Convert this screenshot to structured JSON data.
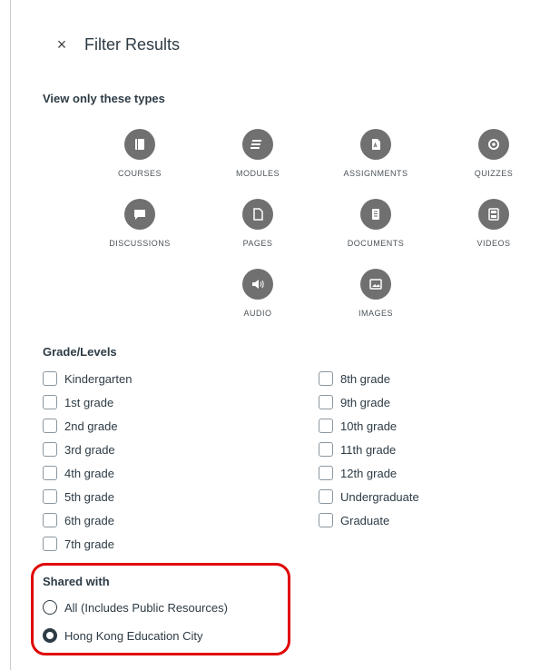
{
  "header": {
    "close_icon": "×",
    "title": "Filter Results"
  },
  "types": {
    "heading": "View only these types",
    "items": [
      {
        "label": "COURSES",
        "icon": "course-icon"
      },
      {
        "label": "MODULES",
        "icon": "modules-icon"
      },
      {
        "label": "ASSIGNMENTS",
        "icon": "assignment-icon"
      },
      {
        "label": "QUIZZES",
        "icon": "quiz-icon"
      },
      {
        "label": "DISCUSSIONS",
        "icon": "discussion-icon"
      },
      {
        "label": "PAGES",
        "icon": "page-icon"
      },
      {
        "label": "DOCUMENTS",
        "icon": "document-icon"
      },
      {
        "label": "VIDEOS",
        "icon": "video-icon"
      },
      {
        "label": "AUDIO",
        "icon": "audio-icon"
      },
      {
        "label": "IMAGES",
        "icon": "image-icon"
      }
    ]
  },
  "grades": {
    "heading": "Grade/Levels",
    "items": [
      "Kindergarten",
      "1st grade",
      "2nd grade",
      "3rd grade",
      "4th grade",
      "5th grade",
      "6th grade",
      "7th grade",
      "8th grade",
      "9th grade",
      "10th grade",
      "11th grade",
      "12th grade",
      "Undergraduate",
      "Graduate"
    ]
  },
  "shared": {
    "heading": "Shared with",
    "options": [
      {
        "label": "All (Includes Public Resources)",
        "selected": false
      },
      {
        "label": "Hong Kong Education City",
        "selected": true
      }
    ],
    "highlight_color": "#e00000"
  },
  "colors": {
    "icon_bg": "#707070",
    "text": "#2d3b45"
  }
}
